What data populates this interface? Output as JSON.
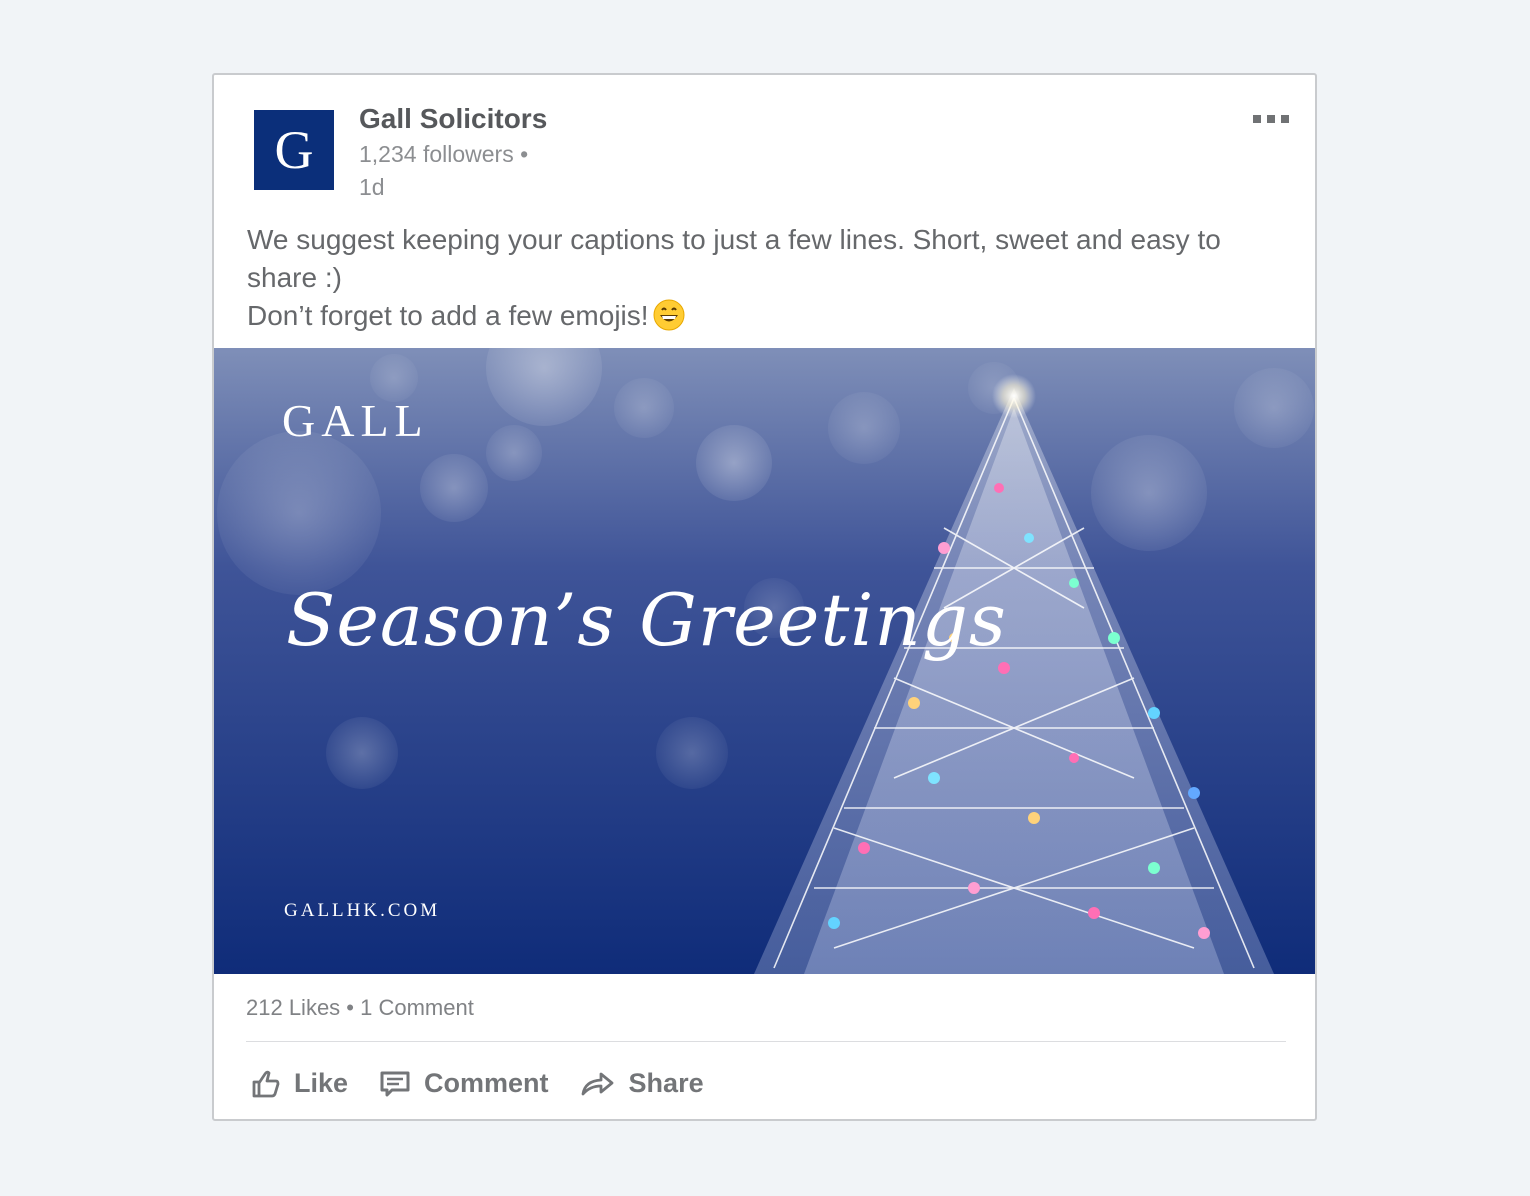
{
  "post": {
    "company": {
      "logo_letter": "G",
      "name": "Gall Solicitors",
      "followers": "1,234 followers •",
      "time": "1d"
    },
    "more_icon": "more-horizontal-icon",
    "caption": {
      "line1": "We suggest keeping your captions to just a few lines. Short, sweet and easy to share :)",
      "line2": "Don’t forget to add a few emojis!",
      "emoji": "grinning-face-emoji"
    },
    "image": {
      "brand": "GALL",
      "greeting": "Season’s Greetings",
      "url": "GALLHK.COM"
    },
    "stats": "212 Likes • 1 Comment",
    "actions": {
      "like": "Like",
      "comment": "Comment",
      "share": "Share"
    }
  },
  "colors": {
    "page_bg": "#f1f4f7",
    "brand_blue": "#0b2f7a",
    "text_dark": "#56585b",
    "text_muted": "#8c8e91"
  }
}
